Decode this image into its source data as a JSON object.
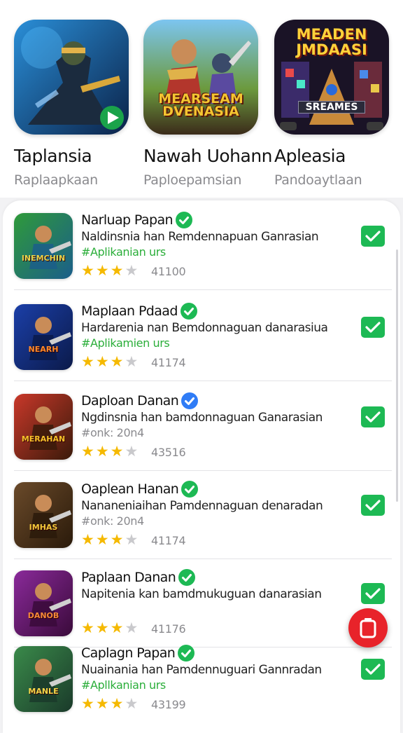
{
  "featured": [
    {
      "title": "Taplansia",
      "subtitle": "Raplaapkaan",
      "icon": "soldier-game-icon",
      "banner_text": ""
    },
    {
      "title": "Nawah Uohann",
      "subtitle": "Paploepamsian",
      "icon": "hero-game-icon",
      "banner_text": "MEARSEAM DVENASIA"
    },
    {
      "title": "Apleasia",
      "subtitle": "Pandoaytlaan",
      "icon": "arcade-game-icon",
      "banner_text": "MEADEN JMDAASI",
      "footer_text": "SREAMES"
    }
  ],
  "apps": [
    {
      "name": "Narluap Papan",
      "desc": "Naldinsnia han Remdennapuan Ganrasian",
      "tag": "#Aplikanian urs",
      "tag_color": "#2bae3a",
      "rating": 3,
      "count": "41100",
      "verified": "green",
      "icon_text": "INEMCHIN"
    },
    {
      "name": "Maplaan Pdaad",
      "desc": "Hardarenia nan Bemdonnaguan danarasiua",
      "tag": "#Aplikamien urs",
      "tag_color": "#2bae3a",
      "rating": 3,
      "count": "41174",
      "verified": "green",
      "icon_text": "NEARH"
    },
    {
      "name": "Daploan Danan",
      "desc": "Ngdinsnia han bamdonnaguan Ganarasian",
      "tag": "#onk: 20n4",
      "tag_color": "#8a8a8e",
      "rating": 3,
      "count": "43516",
      "verified": "blue",
      "icon_text": "MERAHAN"
    },
    {
      "name": "Oaplean Hanan",
      "desc": "Nananeniaihan Pamdennaguan denaradan",
      "tag": "#onk: 20n4",
      "tag_color": "#8a8a8e",
      "rating": 3,
      "count": "41174",
      "verified": "green",
      "icon_text": "IMHAS"
    },
    {
      "name": "Paplaan Danan",
      "desc": "Napitenia kan bamdmukuguan danarasian",
      "tag": "",
      "tag_color": "#8a8a8e",
      "rating": 3,
      "count": "41176",
      "verified": "green",
      "icon_text": "DANOB"
    },
    {
      "name": "Caplagn Papan",
      "desc": "Nuainania han Pamdennuguari Gannradan",
      "tag": "#Apllkanian urs",
      "tag_color": "#2bae3a",
      "rating": 3,
      "count": "43199",
      "verified": "green",
      "icon_text": "MANLE"
    }
  ],
  "colors": {
    "accent_green": "#1db954",
    "star": "#f5b900",
    "fab_red": "#e8232a",
    "verified_blue": "#2f7cf6"
  }
}
